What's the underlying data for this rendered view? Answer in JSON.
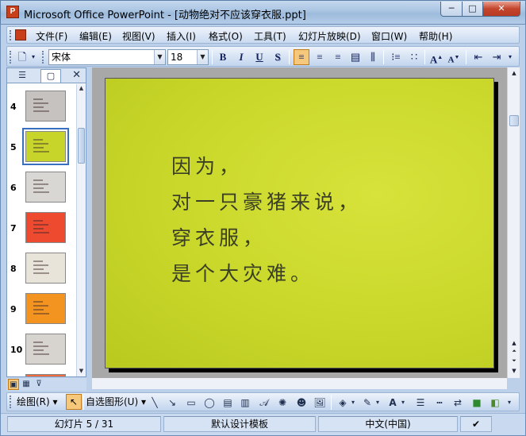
{
  "window": {
    "title": "Microsoft Office PowerPoint - [动物绝对不应该穿衣服.ppt]",
    "min": "─",
    "max": "□",
    "close": "✕"
  },
  "menu": {
    "items": [
      "文件(F)",
      "编辑(E)",
      "视图(V)",
      "插入(I)",
      "格式(O)",
      "工具(T)",
      "幻灯片放映(D)",
      "窗口(W)",
      "帮助(H)"
    ]
  },
  "toolbar": {
    "font": "宋体",
    "size": "18",
    "bold": "B",
    "italic": "I",
    "underline": "U",
    "shadow": "S",
    "grow": "A",
    "shrink": "A"
  },
  "left_pane": {
    "tabs": [
      "outline",
      "slides"
    ],
    "close": "✕",
    "thumbnails": [
      {
        "num": "4",
        "bg": "#c6c2bf",
        "selected": false
      },
      {
        "num": "5",
        "bg": "#c7d52a",
        "selected": true
      },
      {
        "num": "6",
        "bg": "#d9d7d3",
        "selected": false
      },
      {
        "num": "7",
        "bg": "#ee4a2f",
        "selected": false
      },
      {
        "num": "8",
        "bg": "#e8e4da",
        "selected": false
      },
      {
        "num": "9",
        "bg": "#f2941f",
        "selected": false
      },
      {
        "num": "10",
        "bg": "#d7d4cf",
        "selected": false
      },
      {
        "num": "",
        "bg": "#f06a3c",
        "selected": false
      }
    ]
  },
  "slide": {
    "lines": [
      "因为，",
      "对一只豪猪来说，",
      "穿衣服，",
      "是个大灾难。"
    ]
  },
  "drawbar": {
    "draw_label": "绘图(R)",
    "autoshape_label": "自选图形(U)"
  },
  "status": {
    "slide_counter": "幻灯片 5 / 31",
    "template": "默认设计模板",
    "language": "中文(中国)"
  },
  "colors": {
    "accent": "#f6c87c",
    "title_bar": "#a9c4e2",
    "slide_bg": "#c9d72a"
  }
}
